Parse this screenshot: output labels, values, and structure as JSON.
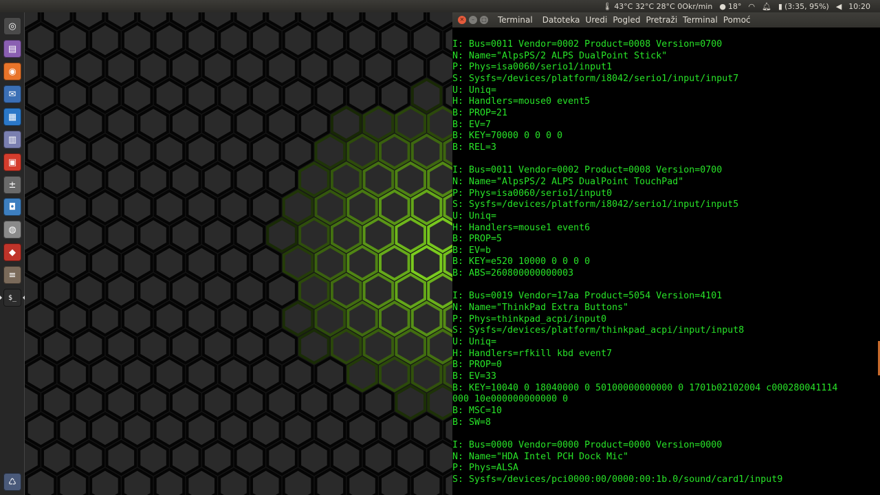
{
  "panel": {
    "temps": "43°C 32°C 28°C 0Okr/min",
    "weather": "18°",
    "battery": "(3:35, 95%)",
    "clock": "10:20",
    "icons": [
      "thermometer-icon",
      "weather-icon",
      "wifi-icon",
      "bell-icon",
      "battery-icon",
      "volume-icon"
    ]
  },
  "launcher": {
    "items": [
      {
        "name": "dash-home",
        "icon": "ubuntu-logo-icon",
        "color": "#4a4a4a",
        "glyph": "◎"
      },
      {
        "name": "files",
        "icon": "folder-icon",
        "color": "#8a5fb2",
        "glyph": "▤"
      },
      {
        "name": "firefox",
        "icon": "firefox-icon",
        "color": "#e8742a",
        "glyph": "◉"
      },
      {
        "name": "thunderbird",
        "icon": "mail-icon",
        "color": "#3b6fb5",
        "glyph": "✉"
      },
      {
        "name": "writer",
        "icon": "document-icon",
        "color": "#2b78c8",
        "glyph": "▦"
      },
      {
        "name": "text-editor",
        "icon": "notepad-icon",
        "color": "#7a7fb0",
        "glyph": "▥"
      },
      {
        "name": "software-center",
        "icon": "bag-icon",
        "color": "#d43d2d",
        "glyph": "▣"
      },
      {
        "name": "calculator",
        "icon": "calculator-icon",
        "color": "#6a6a6a",
        "glyph": "±"
      },
      {
        "name": "screenshot",
        "icon": "camera-icon",
        "color": "#3d7fc0",
        "glyph": "◘"
      },
      {
        "name": "disk-utility",
        "icon": "disk-icon",
        "color": "#8a8a8a",
        "glyph": "◍"
      },
      {
        "name": "app-red",
        "icon": "diamond-icon",
        "color": "#c0342a",
        "glyph": "◆"
      },
      {
        "name": "mixer",
        "icon": "sliders-icon",
        "color": "#7a6a5a",
        "glyph": "≡"
      },
      {
        "name": "terminal",
        "icon": "terminal-icon",
        "color": "#2d2d2d",
        "glyph": "$_"
      },
      {
        "name": "trash",
        "icon": "trash-icon",
        "color": "#4a5a7a",
        "glyph": "♺"
      }
    ]
  },
  "terminal": {
    "title": "Terminal",
    "menu": [
      "Datoteka",
      "Uredi",
      "Pogled",
      "Pretraži",
      "Terminal",
      "Pomoć"
    ],
    "lines": [
      "I: Bus=0011 Vendor=0002 Product=0008 Version=0700",
      "N: Name=\"AlpsPS/2 ALPS DualPoint Stick\"",
      "P: Phys=isa0060/serio1/input1",
      "S: Sysfs=/devices/platform/i8042/serio1/input/input7",
      "U: Uniq=",
      "H: Handlers=mouse0 event5",
      "B: PROP=21",
      "B: EV=7",
      "B: KEY=70000 0 0 0 0",
      "B: REL=3",
      "",
      "I: Bus=0011 Vendor=0002 Product=0008 Version=0700",
      "N: Name=\"AlpsPS/2 ALPS DualPoint TouchPad\"",
      "P: Phys=isa0060/serio1/input0",
      "S: Sysfs=/devices/platform/i8042/serio1/input/input5",
      "U: Uniq=",
      "H: Handlers=mouse1 event6",
      "B: PROP=5",
      "B: EV=b",
      "B: KEY=e520 10000 0 0 0 0",
      "B: ABS=260800000000003",
      "",
      "I: Bus=0019 Vendor=17aa Product=5054 Version=4101",
      "N: Name=\"ThinkPad Extra Buttons\"",
      "P: Phys=thinkpad_acpi/input0",
      "S: Sysfs=/devices/platform/thinkpad_acpi/input/input8",
      "U: Uniq=",
      "H: Handlers=rfkill kbd event7",
      "B: PROP=0",
      "B: EV=33",
      "B: KEY=10040 0 18040000 0 50100000000000 0 1701b02102004 c000280041114",
      "000 10e000000000000 0",
      "B: MSC=10",
      "B: SW=8",
      "",
      "I: Bus=0000 Vendor=0000 Product=0000 Version=0000",
      "N: Name=\"HDA Intel PCH Dock Mic\"",
      "P: Phys=ALSA",
      "S: Sysfs=/devices/pci0000:00/0000:00:1b.0/sound/card1/input9"
    ]
  }
}
